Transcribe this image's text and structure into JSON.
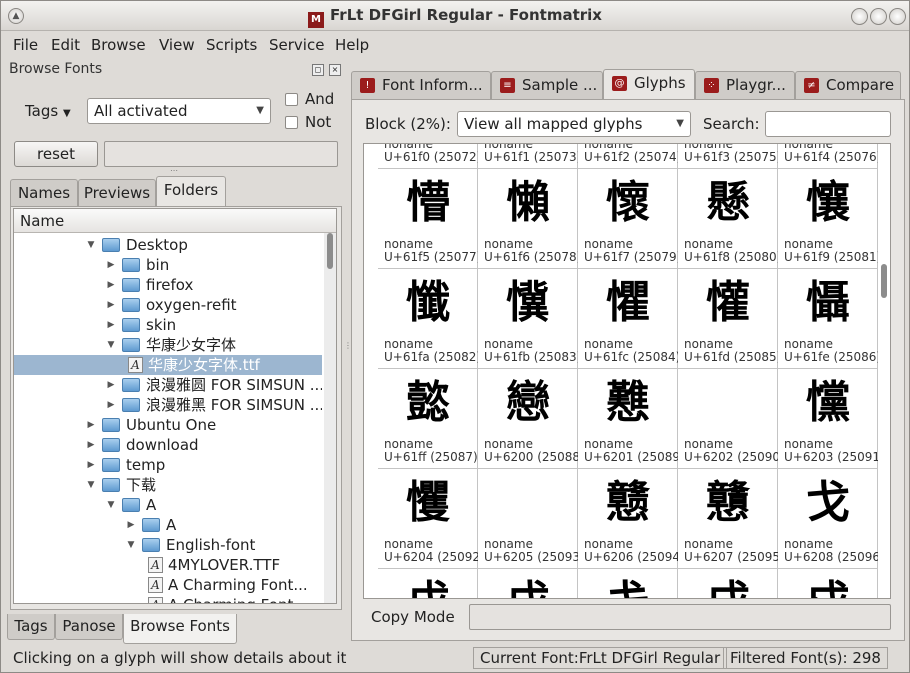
{
  "window": {
    "title": "FrLt DFGirl Regular - Fontmatrix",
    "app_icon_glyph": "M"
  },
  "menu": [
    "File",
    "Edit",
    "Browse",
    "View",
    "Scripts",
    "Service",
    "Help"
  ],
  "left": {
    "panel_title": "Browse Fonts",
    "tags_label": "Tags",
    "tags_value": "All activated",
    "and_label": "And",
    "not_label": "Not",
    "reset_label": "reset",
    "tabs": [
      "Names",
      "Previews",
      "Folders"
    ],
    "active_tab": "Folders",
    "tree_header": "Name",
    "tree": [
      {
        "label": "Desktop",
        "type": "folder",
        "depth": 0,
        "expanded": true
      },
      {
        "label": "bin",
        "type": "folder",
        "depth": 1,
        "expanded": false
      },
      {
        "label": "firefox",
        "type": "folder",
        "depth": 1,
        "expanded": false
      },
      {
        "label": "oxygen-refit",
        "type": "folder",
        "depth": 1,
        "expanded": false
      },
      {
        "label": "skin",
        "type": "folder",
        "depth": 1,
        "expanded": false
      },
      {
        "label": "华康少女字体",
        "type": "folder",
        "depth": 1,
        "expanded": true
      },
      {
        "label": "华康少女字体.ttf",
        "type": "font",
        "depth": 2,
        "selected": true
      },
      {
        "label": "浪漫雅圆 FOR SIMSUN ...",
        "type": "folder",
        "depth": 1,
        "expanded": false
      },
      {
        "label": "浪漫雅黑 FOR SIMSUN ...",
        "type": "folder",
        "depth": 1,
        "expanded": false
      },
      {
        "label": "Ubuntu One",
        "type": "folder",
        "depth": 0,
        "expanded": false
      },
      {
        "label": "download",
        "type": "folder",
        "depth": 0,
        "expanded": false
      },
      {
        "label": "temp",
        "type": "folder",
        "depth": 0,
        "expanded": false
      },
      {
        "label": "下载",
        "type": "folder",
        "depth": 0,
        "expanded": true
      },
      {
        "label": "A",
        "type": "folder",
        "depth": 1,
        "expanded": true
      },
      {
        "label": "A",
        "type": "folder",
        "depth": 2,
        "expanded": false
      },
      {
        "label": "English-font",
        "type": "folder",
        "depth": 2,
        "expanded": true
      },
      {
        "label": "4MYLOVER.TTF",
        "type": "font",
        "depth": 3
      },
      {
        "label": "A Charming Font...",
        "type": "font",
        "depth": 3
      },
      {
        "label": "A Charming Font...",
        "type": "font",
        "depth": 3
      }
    ],
    "bottom_tabs": [
      "Tags",
      "Panose",
      "Browse Fonts"
    ],
    "active_bottom_tab": "Browse Fonts"
  },
  "right": {
    "tabs": [
      {
        "label": "Font Inform...",
        "icon": "info-icon"
      },
      {
        "label": "Sample ...",
        "icon": "sample-icon"
      },
      {
        "label": "Glyphs",
        "icon": "glyphs-icon"
      },
      {
        "label": "Playgr...",
        "icon": "playground-icon"
      },
      {
        "label": "Compare",
        "icon": "compare-icon"
      }
    ],
    "active_tab": "Glyphs",
    "block_label": "Block (2%):",
    "block_value": "View all mapped glyphs",
    "search_label": "Search:",
    "search_value": "",
    "copy_mode_label": "Copy Mode",
    "glyph_rows": [
      [
        {
          "glyph": "",
          "name": "noname",
          "code": "U+61f0 (25072)"
        },
        {
          "glyph": "",
          "name": "noname",
          "code": "U+61f1 (25073)"
        },
        {
          "glyph": "",
          "name": "noname",
          "code": "U+61f2 (25074)"
        },
        {
          "glyph": "",
          "name": "noname",
          "code": "U+61f3 (25075)"
        },
        {
          "glyph": "",
          "name": "noname",
          "code": "U+61f4 (25076)"
        }
      ],
      [
        {
          "glyph": "懵",
          "name": "noname",
          "code": "U+61f5 (25077)"
        },
        {
          "glyph": "懶",
          "name": "noname",
          "code": "U+61f6 (25078)"
        },
        {
          "glyph": "懷",
          "name": "noname",
          "code": "U+61f7 (25079)"
        },
        {
          "glyph": "懸",
          "name": "noname",
          "code": "U+61f8 (25080)"
        },
        {
          "glyph": "懹",
          "name": "noname",
          "code": "U+61f9 (25081)"
        }
      ],
      [
        {
          "glyph": "懺",
          "name": "noname",
          "code": "U+61fa (25082)"
        },
        {
          "glyph": "懻",
          "name": "noname",
          "code": "U+61fb (25083)"
        },
        {
          "glyph": "懼",
          "name": "noname",
          "code": "U+61fc (25084)"
        },
        {
          "glyph": "懽",
          "name": "noname",
          "code": "U+61fd (25085)"
        },
        {
          "glyph": "懾",
          "name": "noname",
          "code": "U+61fe (25086)"
        }
      ],
      [
        {
          "glyph": "懿",
          "name": "noname",
          "code": "U+61ff (25087)"
        },
        {
          "glyph": "戀",
          "name": "noname",
          "code": "U+6200 (25088)"
        },
        {
          "glyph": "戁",
          "name": "noname",
          "code": "U+6201 (25089)"
        },
        {
          "glyph": "",
          "name": "noname",
          "code": "U+6202 (25090)"
        },
        {
          "glyph": "戃",
          "name": "noname",
          "code": "U+6203 (25091)"
        }
      ],
      [
        {
          "glyph": "戄",
          "name": "noname",
          "code": "U+6204 (25092)"
        },
        {
          "glyph": "",
          "name": "noname",
          "code": "U+6205 (25093)"
        },
        {
          "glyph": "戆",
          "name": "noname",
          "code": "U+6206 (25094)"
        },
        {
          "glyph": "戇",
          "name": "noname",
          "code": "U+6207 (25095)"
        },
        {
          "glyph": "戈",
          "name": "noname",
          "code": "U+6208 (25096)"
        }
      ],
      [
        {
          "glyph": "戉",
          "name": "",
          "code": ""
        },
        {
          "glyph": "戊",
          "name": "",
          "code": ""
        },
        {
          "glyph": "戋",
          "name": "",
          "code": ""
        },
        {
          "glyph": "戌",
          "name": "",
          "code": ""
        },
        {
          "glyph": "戍",
          "name": "",
          "code": ""
        }
      ]
    ]
  },
  "status": {
    "message": "Clicking on a glyph will show details about it",
    "current_font": "Current Font:FrLt DFGirl Regular",
    "filtered": "Filtered Font(s): 298"
  }
}
